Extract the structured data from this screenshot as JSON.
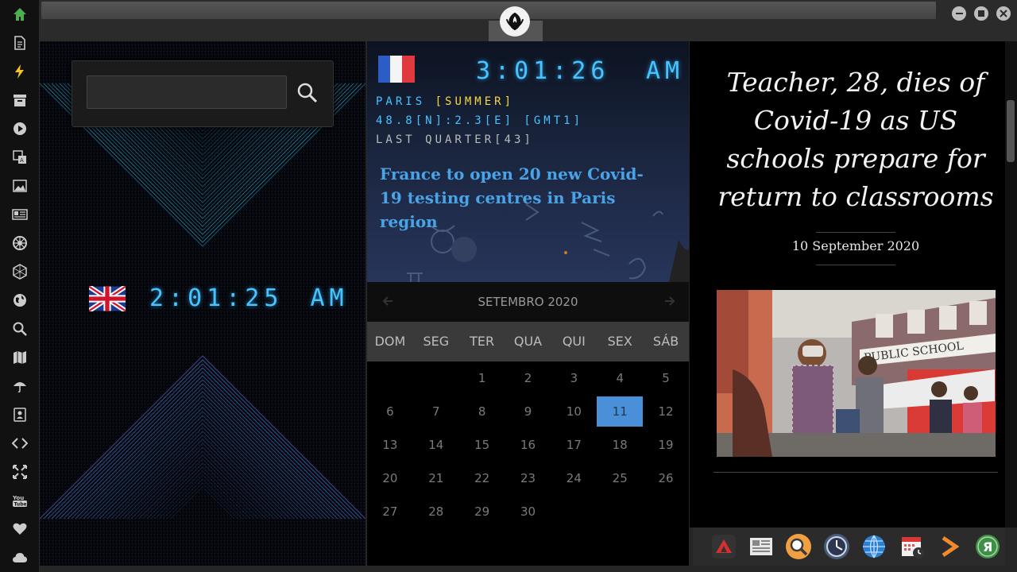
{
  "sidebar": {
    "items": [
      {
        "icon": "home-icon",
        "color": "#4caf50"
      },
      {
        "icon": "document-icon",
        "color": "#cccccc"
      },
      {
        "icon": "lightning-icon",
        "color": "#f5c518"
      },
      {
        "icon": "archive-icon",
        "color": "#cccccc"
      },
      {
        "icon": "play-circle-icon",
        "color": "#cccccc"
      },
      {
        "icon": "translate-icon",
        "color": "#cccccc"
      },
      {
        "icon": "image-icon",
        "color": "#cccccc"
      },
      {
        "icon": "newspaper-icon",
        "color": "#cccccc"
      },
      {
        "icon": "empire-icon",
        "color": "#cccccc"
      },
      {
        "icon": "hexagon-icon",
        "color": "#cccccc"
      },
      {
        "icon": "globe-icon",
        "color": "#cccccc"
      },
      {
        "icon": "search-icon",
        "color": "#cccccc"
      },
      {
        "icon": "map-icon",
        "color": "#cccccc"
      },
      {
        "icon": "umbrella-icon",
        "color": "#cccccc"
      },
      {
        "icon": "contacts-icon",
        "color": "#cccccc"
      },
      {
        "icon": "code-icon",
        "color": "#cccccc"
      },
      {
        "icon": "expand-icon",
        "color": "#cccccc"
      },
      {
        "icon": "youtube-icon",
        "color": "#cccccc"
      },
      {
        "icon": "heart-icon",
        "color": "#cccccc"
      },
      {
        "icon": "cloud-icon",
        "color": "#cccccc"
      }
    ]
  },
  "search": {
    "value": "",
    "placeholder": ""
  },
  "clock_london": {
    "time": "2:01:25",
    "meridiem": "AM"
  },
  "clock_paris": {
    "time": "3:01:26",
    "meridiem": "AM",
    "city": "PARIS",
    "season": "[SUMMER]",
    "coords": "48.8[N]:2.3[E] [GMT1]",
    "moon": "LAST QUARTER[43]"
  },
  "paris_news": "France to open 20 new Covid-19 testing centres in Paris region",
  "calendar": {
    "title": "SETEMBRO 2020",
    "weekdays": [
      "DOM",
      "SEG",
      "TER",
      "QUA",
      "QUI",
      "SEX",
      "SÁB"
    ],
    "days": [
      "",
      "",
      "1",
      "2",
      "3",
      "4",
      "5",
      "6",
      "7",
      "8",
      "9",
      "10",
      "11",
      "12",
      "13",
      "14",
      "15",
      "16",
      "17",
      "18",
      "19",
      "20",
      "21",
      "22",
      "23",
      "24",
      "25",
      "26",
      "27",
      "28",
      "29",
      "30"
    ],
    "selected": "11"
  },
  "news": {
    "headline": "Teacher, 28, dies of Covid-19 as US schools prepare for return to classrooms",
    "date": "10 September 2020",
    "image_sign": "PUBLIC SCHOOL"
  },
  "dock": {
    "items": [
      "arrow-app-icon",
      "news-app-icon",
      "search-app-icon",
      "clock-app-icon",
      "globe-app-icon",
      "calendar-app-icon",
      "forward-app-icon",
      "yandex-app-icon"
    ]
  },
  "colors": {
    "lcd": "#45c4ff",
    "accent": "#4a90d9",
    "paris_season": "#f5d742"
  }
}
